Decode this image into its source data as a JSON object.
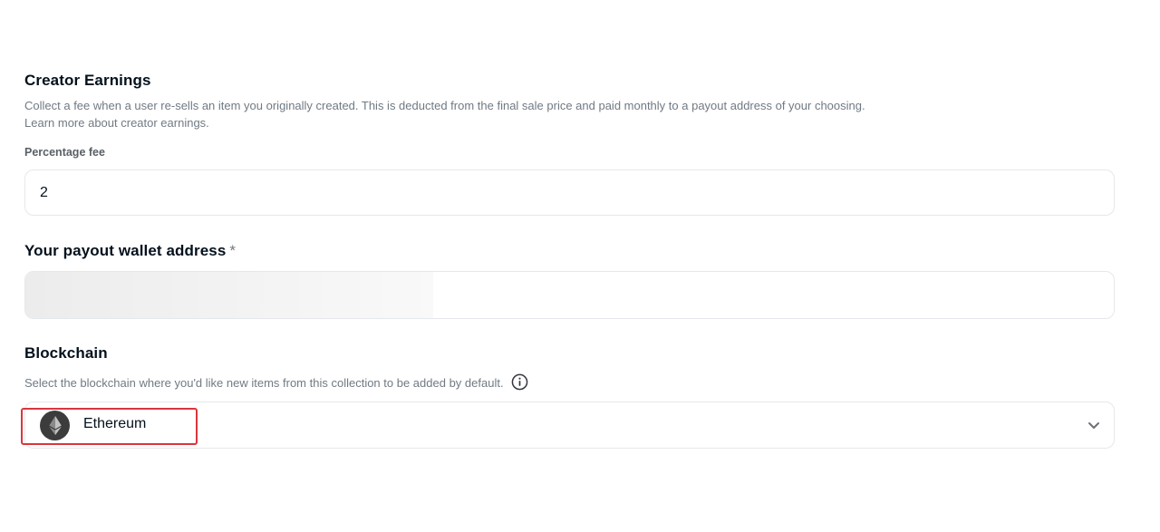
{
  "creator_earnings": {
    "title": "Creator Earnings",
    "description": "Collect a fee when a user re-sells an item you originally created. This is deducted from the final sale price and paid monthly to a payout address of your choosing.",
    "learn_more": "Learn more about creator earnings.",
    "fee_label": "Percentage fee",
    "fee_value": "2"
  },
  "payout": {
    "title": "Your payout wallet address",
    "required_marker": "*"
  },
  "blockchain": {
    "title": "Blockchain",
    "description": "Select the blockchain where you'd like new items from this collection to be added by default.",
    "selected": "Ethereum",
    "icon": "ethereum-icon"
  },
  "colors": {
    "highlight": "#d9363e",
    "border": "#e5e8eb",
    "text_secondary": "#707a83"
  }
}
